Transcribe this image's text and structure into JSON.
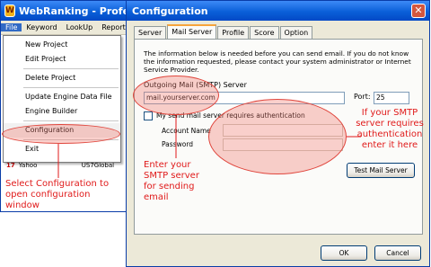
{
  "app": {
    "title": "WebRanking - Professional",
    "menubar": [
      "File",
      "Keyword",
      "LookUp",
      "Report"
    ],
    "menu_items": [
      "New Project",
      "Edit Project",
      "Delete Project",
      "Update Engine Data File",
      "Engine Builder",
      "Configuration",
      "Exit"
    ],
    "list_row": {
      "rank": "17",
      "engine": "Yahoo",
      "region": "US7Global"
    }
  },
  "dialog": {
    "title": "Configuration",
    "tabs": [
      "Server",
      "Mail Server",
      "Profile",
      "Score",
      "Option"
    ],
    "selected_tab": "Mail Server",
    "info_text": "The information below is needed before you can send email. If you do not know the information requested, please contact your system administrator or Internet Service Provider.",
    "smtp_label": "Outgoing Mail (SMTP) Server",
    "smtp_value": "mail.yourserver.com",
    "port_label": "Port:",
    "port_value": "25",
    "auth_checkbox_label": "My send mail server requires authentication",
    "account_label": "Account Name",
    "password_label": "Password",
    "test_button": "Test Mail Server",
    "ok_button": "OK",
    "cancel_button": "Cancel"
  },
  "annotations": {
    "select_config": "Select Configuration to open configuration window",
    "enter_smtp": "Enter your SMTP server for sending email",
    "auth_note": "If your SMTP server requires authentication enter it here"
  },
  "colors": {
    "annotation": "#e01a1a",
    "titlebar": "#0a5fd8"
  }
}
